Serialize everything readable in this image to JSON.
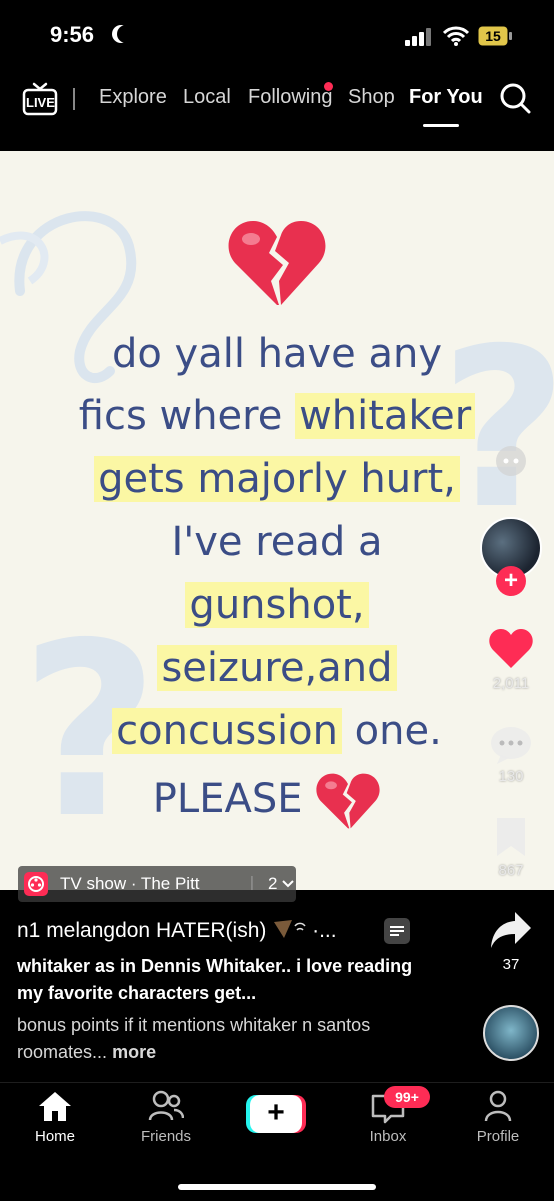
{
  "status_bar": {
    "time": "9:56",
    "battery": "15"
  },
  "top_nav": {
    "live_label": "LIVE",
    "tabs": [
      "Explore",
      "Local",
      "Following",
      "Shop",
      "For You"
    ],
    "active_tab": "For You"
  },
  "video": {
    "text_lines": [
      "do yall have any",
      "fics where",
      "whitaker",
      "gets majorly hurt,",
      "I've read a",
      "gunshot,",
      "seizure,and",
      "concussion",
      "one.",
      "PLEASE"
    ],
    "emoji": "broken-heart"
  },
  "right_rail": {
    "likes": "2,011",
    "comments": "130",
    "bookmarks": "867",
    "shares": "37"
  },
  "post": {
    "tv_chip": {
      "label": "TV show · The Pitt",
      "separator": "|",
      "count": "2"
    },
    "author": "n1 melangdon HATER(ish)",
    "author_suffix": "·...",
    "caption_bold": "whitaker as in Dennis Whitaker.. i love reading my favorite characters get...",
    "caption_normal": "bonus points if it mentions whitaker n santos roomates...",
    "more": "more"
  },
  "tab_bar": {
    "home": "Home",
    "friends": "Friends",
    "create": "+",
    "inbox": "Inbox",
    "inbox_badge": "99+",
    "profile": "Profile"
  },
  "colors": {
    "accent": "#fe2c55",
    "text_blue": "#3b4d86",
    "highlight": "#fbf7a4",
    "video_bg": "#f6f5ec"
  }
}
